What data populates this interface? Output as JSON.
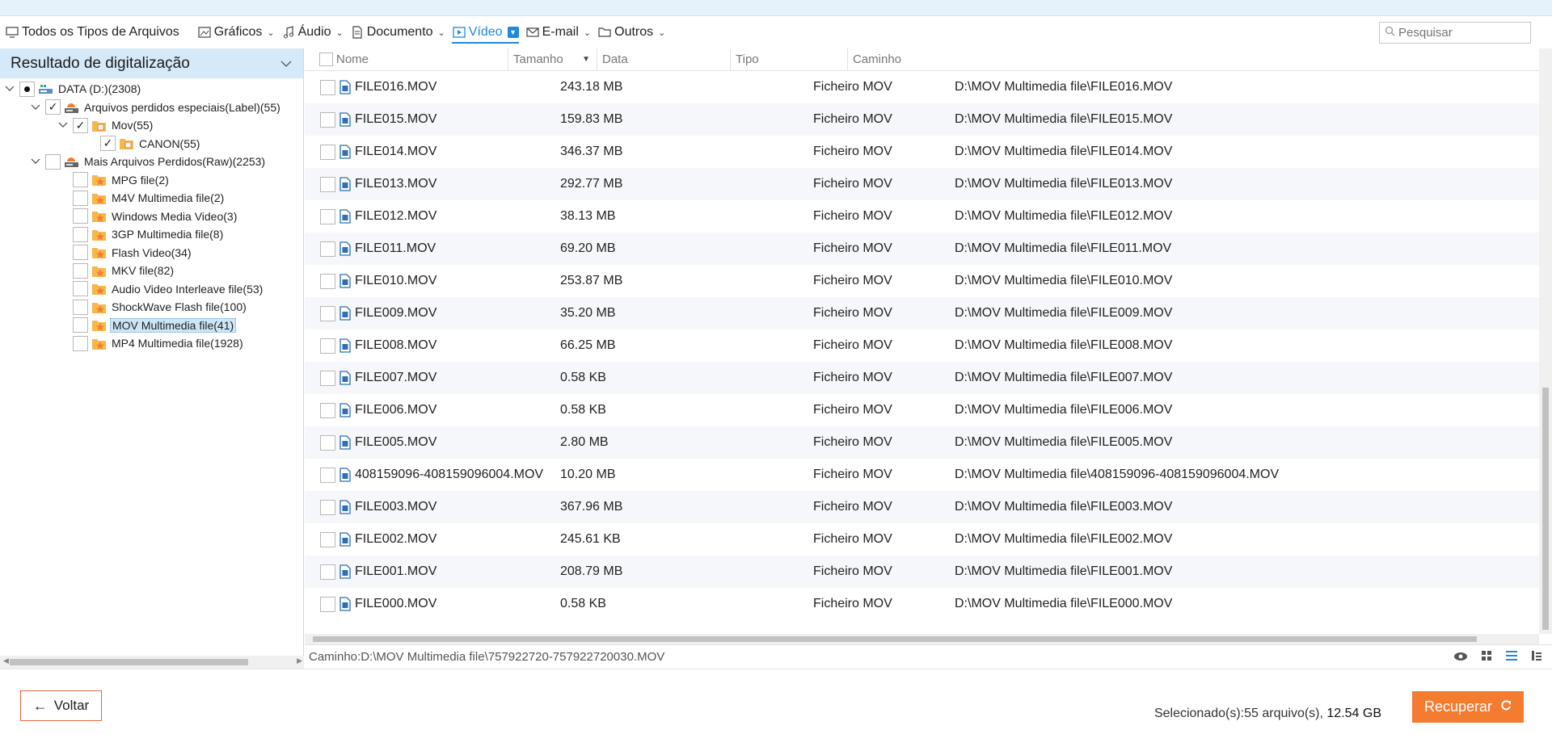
{
  "toolbar": {
    "items": [
      {
        "label": "Todos os Tipos de Arquivos",
        "icon": "monitor-icon",
        "has_menu": false,
        "active": false
      },
      {
        "label": "Gráficos",
        "icon": "image-icon",
        "has_menu": true,
        "active": false
      },
      {
        "label": "Áudio",
        "icon": "music-icon",
        "has_menu": true,
        "active": false
      },
      {
        "label": "Documento",
        "icon": "document-icon",
        "has_menu": true,
        "active": false
      },
      {
        "label": "Vídeo",
        "icon": "video-icon",
        "has_menu": true,
        "active": true
      },
      {
        "label": "E-mail",
        "icon": "mail-icon",
        "has_menu": true,
        "active": false
      },
      {
        "label": "Outros",
        "icon": "folder-icon",
        "has_menu": true,
        "active": false
      }
    ],
    "search_placeholder": "Pesquisar"
  },
  "left_panel": {
    "title": "Resultado de digitalização",
    "tree": [
      {
        "label": "DATA (D:)(2308)",
        "level": 0,
        "expanded": true,
        "check": "partial",
        "icon": "drive-icon",
        "selected": false
      },
      {
        "label": "Arquivos perdidos especiais(Label)(55)",
        "level": 1,
        "expanded": true,
        "check": "checked",
        "icon": "lost-drive-icon",
        "selected": false
      },
      {
        "label": "Mov(55)",
        "level": 2,
        "expanded": true,
        "check": "checked",
        "icon": "folder-tag-icon",
        "selected": false
      },
      {
        "label": "CANON(55)",
        "level": 3,
        "expanded": null,
        "check": "checked",
        "icon": "folder-tag-icon",
        "selected": false
      },
      {
        "label": "Mais Arquivos Perdidos(Raw)(2253)",
        "level": 1,
        "expanded": true,
        "check": "unchecked",
        "icon": "lost-drive-icon",
        "selected": false
      },
      {
        "label": "MPG file(2)",
        "level": 2,
        "expanded": null,
        "check": "unchecked",
        "icon": "folder-star-icon",
        "selected": false
      },
      {
        "label": "M4V Multimedia file(2)",
        "level": 2,
        "expanded": null,
        "check": "unchecked",
        "icon": "folder-star-icon",
        "selected": false
      },
      {
        "label": "Windows Media Video(3)",
        "level": 2,
        "expanded": null,
        "check": "unchecked",
        "icon": "folder-star-icon",
        "selected": false
      },
      {
        "label": "3GP Multimedia file(8)",
        "level": 2,
        "expanded": null,
        "check": "unchecked",
        "icon": "folder-star-icon",
        "selected": false
      },
      {
        "label": "Flash Video(34)",
        "level": 2,
        "expanded": null,
        "check": "unchecked",
        "icon": "folder-star-icon",
        "selected": false
      },
      {
        "label": "MKV file(82)",
        "level": 2,
        "expanded": null,
        "check": "unchecked",
        "icon": "folder-star-icon",
        "selected": false
      },
      {
        "label": "Audio Video Interleave file(53)",
        "level": 2,
        "expanded": null,
        "check": "unchecked",
        "icon": "folder-star-icon",
        "selected": false
      },
      {
        "label": "ShockWave Flash file(100)",
        "level": 2,
        "expanded": null,
        "check": "unchecked",
        "icon": "folder-star-icon",
        "selected": false
      },
      {
        "label": "MOV Multimedia file(41)",
        "level": 2,
        "expanded": null,
        "check": "unchecked",
        "icon": "folder-star-icon",
        "selected": true
      },
      {
        "label": "MP4 Multimedia file(1928)",
        "level": 2,
        "expanded": null,
        "check": "unchecked",
        "icon": "folder-star-icon",
        "selected": false
      }
    ]
  },
  "grid": {
    "columns": {
      "name": "Nome",
      "size": "Tamanho",
      "date": "Data",
      "type": "Tipo",
      "path": "Caminho"
    },
    "rows": [
      {
        "name": "FILE016.MOV",
        "size": "243.18 MB",
        "date": "",
        "type": "Ficheiro MOV",
        "path": "D:\\MOV Multimedia file\\FILE016.MOV"
      },
      {
        "name": "FILE015.MOV",
        "size": "159.83 MB",
        "date": "",
        "type": "Ficheiro MOV",
        "path": "D:\\MOV Multimedia file\\FILE015.MOV"
      },
      {
        "name": "FILE014.MOV",
        "size": "346.37 MB",
        "date": "",
        "type": "Ficheiro MOV",
        "path": "D:\\MOV Multimedia file\\FILE014.MOV"
      },
      {
        "name": "FILE013.MOV",
        "size": "292.77 MB",
        "date": "",
        "type": "Ficheiro MOV",
        "path": "D:\\MOV Multimedia file\\FILE013.MOV"
      },
      {
        "name": "FILE012.MOV",
        "size": "38.13 MB",
        "date": "",
        "type": "Ficheiro MOV",
        "path": "D:\\MOV Multimedia file\\FILE012.MOV"
      },
      {
        "name": "FILE011.MOV",
        "size": "69.20 MB",
        "date": "",
        "type": "Ficheiro MOV",
        "path": "D:\\MOV Multimedia file\\FILE011.MOV"
      },
      {
        "name": "FILE010.MOV",
        "size": "253.87 MB",
        "date": "",
        "type": "Ficheiro MOV",
        "path": "D:\\MOV Multimedia file\\FILE010.MOV"
      },
      {
        "name": "FILE009.MOV",
        "size": "35.20 MB",
        "date": "",
        "type": "Ficheiro MOV",
        "path": "D:\\MOV Multimedia file\\FILE009.MOV"
      },
      {
        "name": "FILE008.MOV",
        "size": "66.25 MB",
        "date": "",
        "type": "Ficheiro MOV",
        "path": "D:\\MOV Multimedia file\\FILE008.MOV"
      },
      {
        "name": "FILE007.MOV",
        "size": "0.58 KB",
        "date": "",
        "type": "Ficheiro MOV",
        "path": "D:\\MOV Multimedia file\\FILE007.MOV"
      },
      {
        "name": "FILE006.MOV",
        "size": "0.58 KB",
        "date": "",
        "type": "Ficheiro MOV",
        "path": "D:\\MOV Multimedia file\\FILE006.MOV"
      },
      {
        "name": "FILE005.MOV",
        "size": "2.80 MB",
        "date": "",
        "type": "Ficheiro MOV",
        "path": "D:\\MOV Multimedia file\\FILE005.MOV"
      },
      {
        "name": "408159096-408159096004.MOV",
        "size": "10.20 MB",
        "date": "",
        "type": "Ficheiro MOV",
        "path": "D:\\MOV Multimedia file\\408159096-408159096004.MOV"
      },
      {
        "name": "FILE003.MOV",
        "size": "367.96 MB",
        "date": "",
        "type": "Ficheiro MOV",
        "path": "D:\\MOV Multimedia file\\FILE003.MOV"
      },
      {
        "name": "FILE002.MOV",
        "size": "245.61 KB",
        "date": "",
        "type": "Ficheiro MOV",
        "path": "D:\\MOV Multimedia file\\FILE002.MOV"
      },
      {
        "name": "FILE001.MOV",
        "size": "208.79 MB",
        "date": "",
        "type": "Ficheiro MOV",
        "path": "D:\\MOV Multimedia file\\FILE001.MOV"
      },
      {
        "name": "FILE000.MOV",
        "size": "0.58 KB",
        "date": "",
        "type": "Ficheiro MOV",
        "path": "D:\\MOV Multimedia file\\FILE000.MOV"
      }
    ]
  },
  "pathbar": {
    "text": "Caminho:D:\\MOV Multimedia file\\757922720-757922720030.MOV"
  },
  "footer": {
    "back_label": "Voltar",
    "selected_prefix": "Selecionado(s):55 arquivo(s), ",
    "selected_size": "12.54 GB",
    "recover_label": "Recuperar"
  },
  "colors": {
    "accent": "#1e88e5",
    "recover": "#f47c30",
    "back_border": "#e0693b",
    "panel_header": "#d6e9f8"
  }
}
